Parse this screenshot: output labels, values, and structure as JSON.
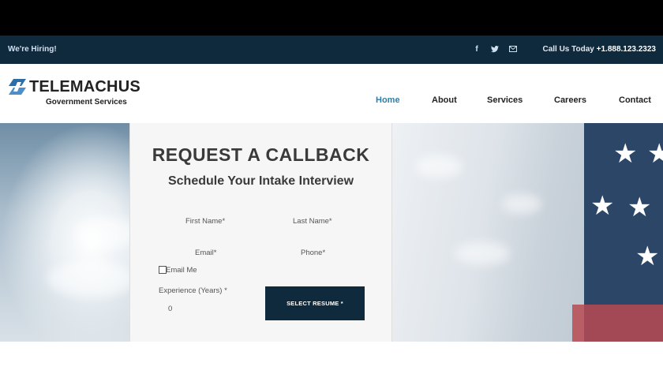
{
  "topbar": {
    "hiring": "We're Hiring!",
    "call_label": "Call Us Today",
    "call_number": "+1.888.123.2323",
    "social_icons": [
      "facebook-icon",
      "twitter-icon",
      "email-icon"
    ],
    "bg_color": "#0f2a3d"
  },
  "header": {
    "brand": "TELEMACHUS",
    "subbrand": "Government Services",
    "nav": [
      {
        "label": "Home",
        "active": true
      },
      {
        "label": "About",
        "active": false
      },
      {
        "label": "Services",
        "active": false
      },
      {
        "label": "Careers",
        "active": false
      },
      {
        "label": "Contact",
        "active": false
      }
    ],
    "active_color": "#2b7fa9"
  },
  "form": {
    "title": "REQUEST A CALLBACK",
    "subtitle": "Schedule Your Intake Interview",
    "first_name": "First Name*",
    "last_name": "Last Name*",
    "email": "Email*",
    "phone": "Phone*",
    "email_me": "Email Me",
    "experience": "Experience (Years) *",
    "experience_value": "0",
    "resume_button": "SELECT RESUME *"
  }
}
